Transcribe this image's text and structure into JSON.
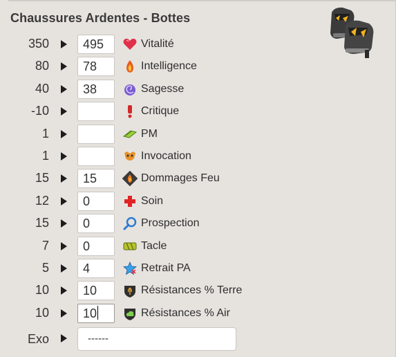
{
  "item": {
    "name": "Chaussures Ardentes - Bottes"
  },
  "rows": [
    {
      "base": "350",
      "value": "495",
      "stat": "Vitalité",
      "icon": "heart-icon"
    },
    {
      "base": "80",
      "value": "78",
      "stat": "Intelligence",
      "icon": "fire-icon"
    },
    {
      "base": "40",
      "value": "38",
      "stat": "Sagesse",
      "icon": "swirl-icon"
    },
    {
      "base": "-10",
      "value": "",
      "stat": "Critique",
      "icon": "exclamation-icon"
    },
    {
      "base": "1",
      "value": "",
      "stat": "PM",
      "icon": "movement-point-icon"
    },
    {
      "base": "1",
      "value": "",
      "stat": "Invocation",
      "icon": "summon-icon"
    },
    {
      "base": "15",
      "value": "15",
      "stat": "Dommages Feu",
      "icon": "fire-damage-icon"
    },
    {
      "base": "12",
      "value": "0",
      "stat": "Soin",
      "icon": "heal-cross-icon"
    },
    {
      "base": "15",
      "value": "0",
      "stat": "Prospection",
      "icon": "magnifier-icon"
    },
    {
      "base": "7",
      "value": "0",
      "stat": "Tacle",
      "icon": "tackle-icon"
    },
    {
      "base": "5",
      "value": "4",
      "stat": "Retrait PA",
      "icon": "ap-reduction-icon"
    },
    {
      "base": "10",
      "value": "10",
      "stat": "Résistances % Terre",
      "icon": "earth-resistance-icon"
    },
    {
      "base": "10",
      "value": "10",
      "stat": "Résistances % Air",
      "icon": "air-resistance-icon"
    }
  ],
  "exo": {
    "label": "Exo",
    "value": "------"
  }
}
